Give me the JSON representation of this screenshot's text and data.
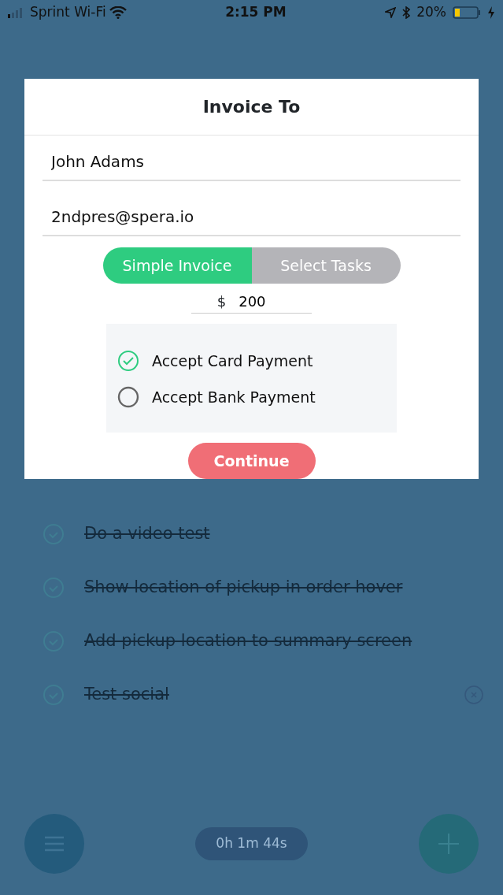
{
  "status_bar": {
    "carrier": "Sprint Wi-Fi",
    "time": "2:15 PM",
    "battery": "20%"
  },
  "dialog": {
    "title": "Invoice To",
    "fields": [
      {
        "value": "John Adams"
      },
      {
        "value": "2ndpres@spera.io"
      }
    ],
    "segments": [
      {
        "label": "Simple Invoice",
        "selected": true
      },
      {
        "label": "Select Tasks",
        "selected": false
      }
    ],
    "amount": {
      "currency": "$",
      "value": "200"
    },
    "options": [
      {
        "label": "Accept Card Payment",
        "checked": true
      },
      {
        "label": "Accept Bank Payment",
        "checked": false
      }
    ],
    "continue": "Continue"
  },
  "tasks": [
    {
      "text": "Do a video test",
      "done": true
    },
    {
      "text": "Show location of pickup in order hover",
      "done": true
    },
    {
      "text": "Add pickup location to summary screen",
      "done": true
    },
    {
      "text": "Test social",
      "done": true,
      "removable": true
    }
  ],
  "timer": "0h 1m 44s"
}
